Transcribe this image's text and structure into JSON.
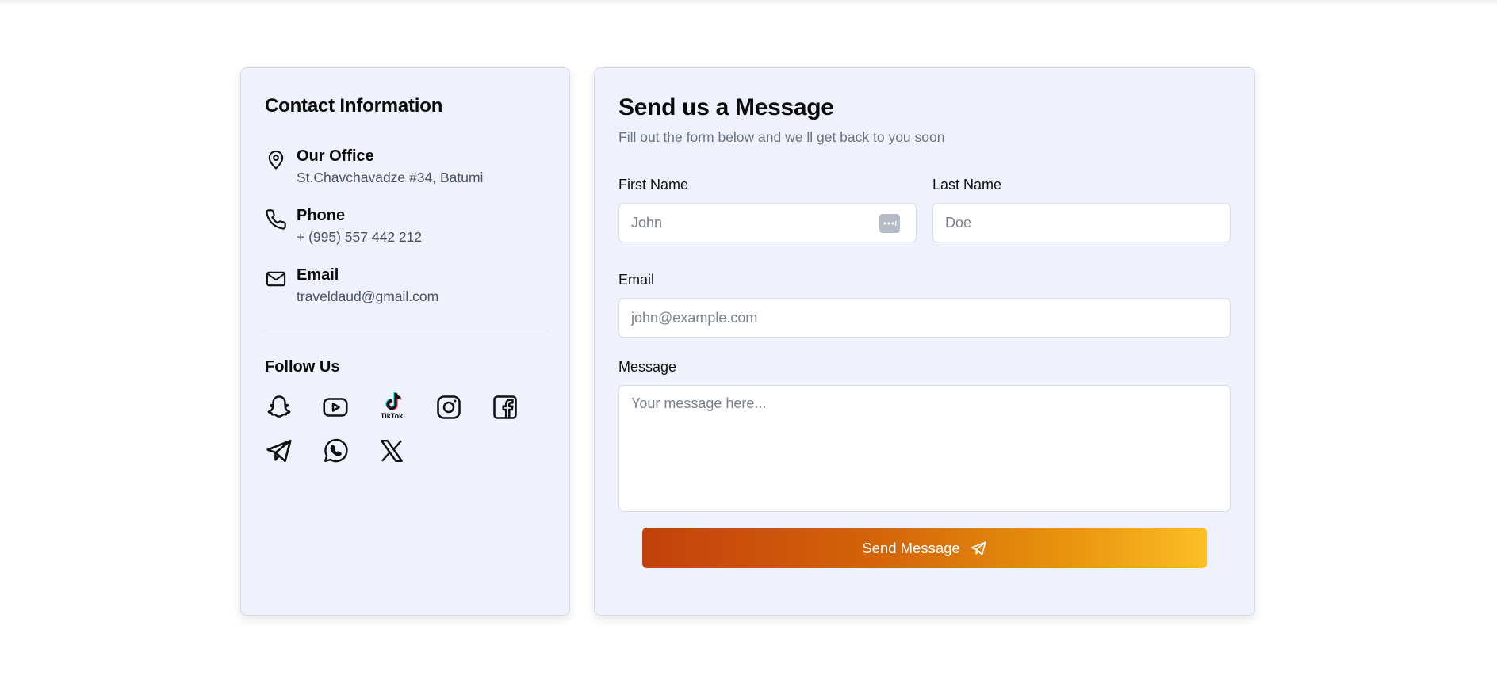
{
  "contact": {
    "title": "Contact Information",
    "office": {
      "title": "Our Office",
      "value": "St.Chavchavadze #34, Batumi",
      "icon": "map-pin-icon"
    },
    "phone": {
      "title": "Phone",
      "value": "+ (995) 557 442 212",
      "icon": "phone-icon"
    },
    "email": {
      "title": "Email",
      "value": "traveldaud@gmail.com",
      "icon": "mail-icon"
    },
    "follow_title": "Follow Us",
    "socials": [
      "snapchat-icon",
      "youtube-icon",
      "tiktok-icon",
      "instagram-icon",
      "facebook-icon",
      "telegram-icon",
      "whatsapp-icon",
      "x-icon"
    ],
    "tiktok_wordmark": "TikTok"
  },
  "form": {
    "title": "Send us a Message",
    "subtitle": "Fill out the form below and we ll get back to you soon",
    "first_name": {
      "label": "First Name",
      "placeholder": "John"
    },
    "last_name": {
      "label": "Last Name",
      "placeholder": "Doe"
    },
    "email": {
      "label": "Email",
      "placeholder": "john@example.com"
    },
    "message": {
      "label": "Message",
      "placeholder": "Your message here..."
    },
    "submit_label": "Send Message"
  },
  "colors": {
    "card_bg": "#eff2fd",
    "button_gradient_start": "#c2410c",
    "button_gradient_end": "#fbbf24"
  }
}
